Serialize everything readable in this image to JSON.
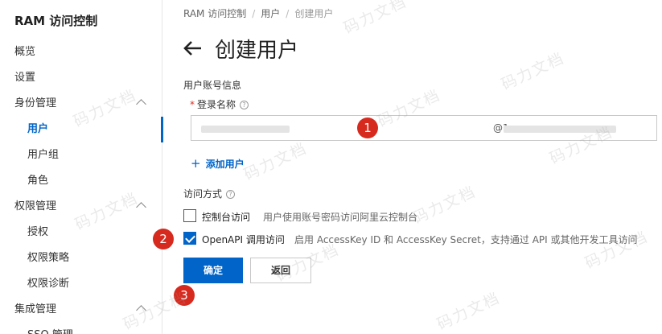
{
  "sidebar": {
    "title": "RAM 访问控制",
    "items": [
      {
        "label": "概览"
      },
      {
        "label": "设置"
      },
      {
        "label": "身份管理"
      },
      {
        "label": "用户"
      },
      {
        "label": "用户组"
      },
      {
        "label": "角色"
      },
      {
        "label": "权限管理"
      },
      {
        "label": "授权"
      },
      {
        "label": "权限策略"
      },
      {
        "label": "权限诊断"
      },
      {
        "label": "集成管理"
      },
      {
        "label": "SSO 管理"
      }
    ]
  },
  "breadcrumb": [
    "RAM 访问控制",
    "用户",
    "创建用户"
  ],
  "breadcrumb_separator": "/",
  "page": {
    "title": "创建用户",
    "back_icon": "arrow-left-icon"
  },
  "account_info": {
    "section_label": "用户账号信息",
    "required_mark": "*",
    "login_name_label": "登录名称",
    "help_icon": "?",
    "login_domain": "@1                              n.com",
    "add_user_icon": "+",
    "add_user_label": "添加用户"
  },
  "access": {
    "section_label": "访问方式",
    "help_icon": "?",
    "console": {
      "label": "控制台访问",
      "desc": "用户使用账号密码访问阿里云控制台",
      "checked": false
    },
    "openapi": {
      "label": "OpenAPI 调用访问",
      "desc": "启用 AccessKey ID 和 AccessKey Secret，支持通过 API 或其他开发工具访问",
      "checked": true
    }
  },
  "buttons": {
    "confirm": "确定",
    "back": "返回"
  },
  "steps": [
    "1",
    "2",
    "3"
  ],
  "watermark": "码力文档",
  "colors": {
    "primary": "#0064c8",
    "step_marker": "#d62a1f"
  }
}
